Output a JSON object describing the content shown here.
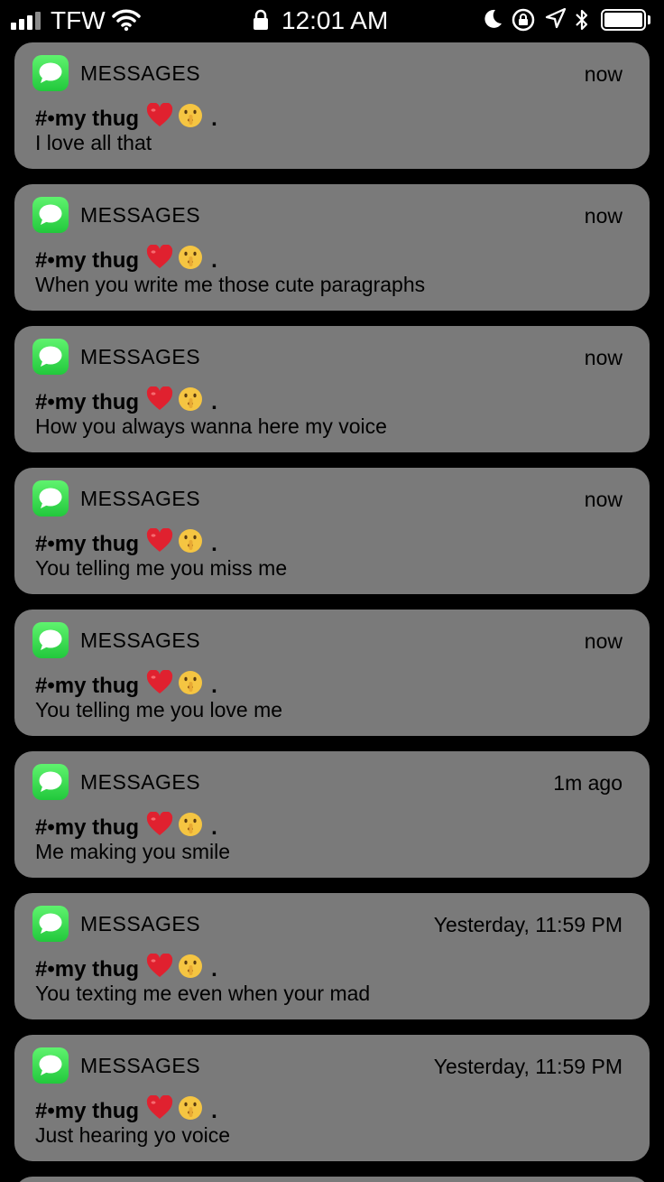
{
  "status_bar": {
    "carrier": "TFW",
    "time": "12:01 AM",
    "signal_bars_active": 3,
    "signal_bars_total": 4,
    "battery_level": 1.0,
    "icons": [
      "wifi-icon",
      "lock-icon",
      "moon-icon",
      "rotation-lock-icon",
      "location-icon",
      "bluetooth-icon",
      "battery-icon"
    ]
  },
  "accent": {
    "messages_green": "#34c759",
    "card_background": "#7a7a7a",
    "heart_red": "#e0212f",
    "face_yellow": "#f5c542"
  },
  "notifications": [
    {
      "app": "MESSAGES",
      "time": "now",
      "sender": "#•my thug",
      "emoji_heart": "❤️",
      "emoji_face": "shushing-face",
      "suffix": ".",
      "body": "I love all that"
    },
    {
      "app": "MESSAGES",
      "time": "now",
      "sender": "#•my thug",
      "emoji_heart": "❤️",
      "emoji_face": "shushing-face",
      "suffix": ".",
      "body": "When you write me those cute paragraphs"
    },
    {
      "app": "MESSAGES",
      "time": "now",
      "sender": "#•my thug",
      "emoji_heart": "❤️",
      "emoji_face": "shushing-face",
      "suffix": ".",
      "body": "How you always wanna here my voice"
    },
    {
      "app": "MESSAGES",
      "time": "now",
      "sender": "#•my thug",
      "emoji_heart": "❤️",
      "emoji_face": "shushing-face",
      "suffix": ".",
      "body": "You telling me you miss me"
    },
    {
      "app": "MESSAGES",
      "time": "now",
      "sender": "#•my thug",
      "emoji_heart": "❤️",
      "emoji_face": "shushing-face",
      "suffix": ".",
      "body": "You telling me you love me"
    },
    {
      "app": "MESSAGES",
      "time": "1m ago",
      "sender": "#•my thug",
      "emoji_heart": "❤️",
      "emoji_face": "shushing-face",
      "suffix": ".",
      "body": "Me making you smile"
    },
    {
      "app": "MESSAGES",
      "time": "Yesterday, 11:59 PM",
      "sender": "#•my thug",
      "emoji_heart": "❤️",
      "emoji_face": "shushing-face",
      "suffix": ".",
      "body": "You texting me even when your mad"
    },
    {
      "app": "MESSAGES",
      "time": "Yesterday, 11:59 PM",
      "sender": "#•my thug",
      "emoji_heart": "❤️",
      "emoji_face": "shushing-face",
      "suffix": ".",
      "body": "Just hearing yo voice"
    }
  ]
}
